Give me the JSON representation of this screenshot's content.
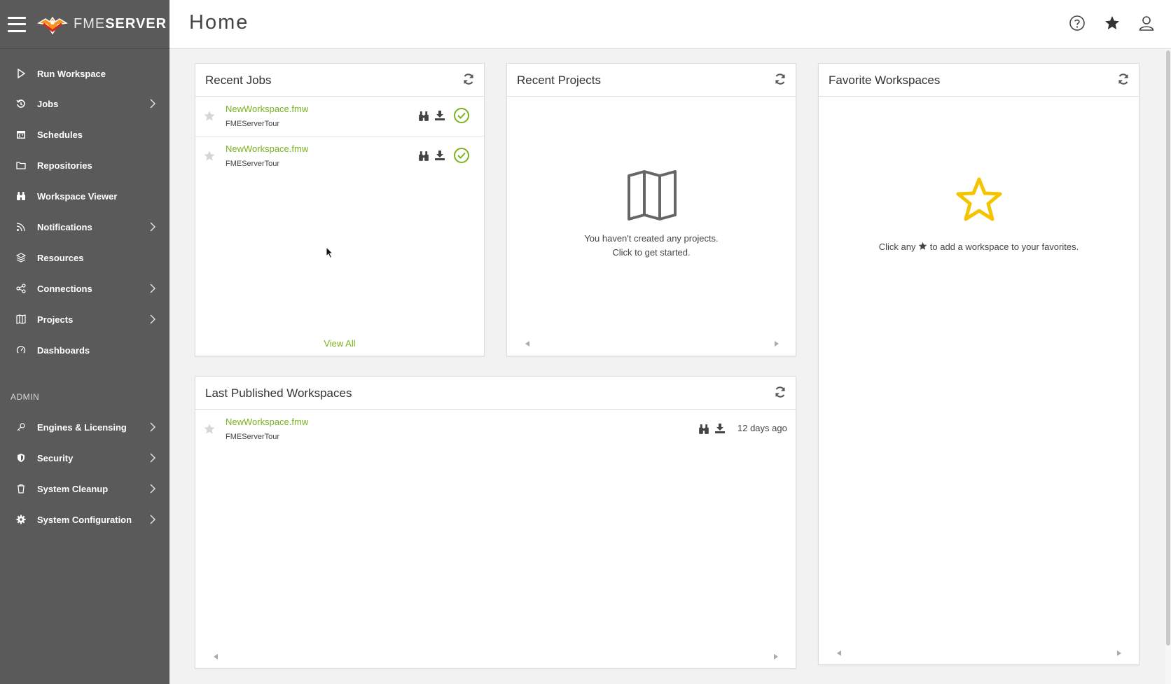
{
  "brand": {
    "name_thin": "FME",
    "name_bold": "SERVER"
  },
  "header": {
    "title": "Home"
  },
  "sidebar": {
    "items": [
      {
        "label": "Run Workspace",
        "icon": "play-outline-icon",
        "has_submenu": false
      },
      {
        "label": "Jobs",
        "icon": "history-icon",
        "has_submenu": true
      },
      {
        "label": "Schedules",
        "icon": "calendar-icon",
        "has_submenu": false
      },
      {
        "label": "Repositories",
        "icon": "folder-icon",
        "has_submenu": false
      },
      {
        "label": "Workspace Viewer",
        "icon": "binoculars-icon",
        "has_submenu": false
      },
      {
        "label": "Notifications",
        "icon": "rss-icon",
        "has_submenu": true
      },
      {
        "label": "Resources",
        "icon": "layers-icon",
        "has_submenu": false
      },
      {
        "label": "Connections",
        "icon": "share-icon",
        "has_submenu": true
      },
      {
        "label": "Projects",
        "icon": "map-icon",
        "has_submenu": true
      },
      {
        "label": "Dashboards",
        "icon": "gauge-icon",
        "has_submenu": false
      }
    ],
    "admin_label": "ADMIN",
    "admin_items": [
      {
        "label": "Engines & Licensing",
        "icon": "key-icon",
        "has_submenu": true
      },
      {
        "label": "Security",
        "icon": "shield-icon",
        "has_submenu": true
      },
      {
        "label": "System Cleanup",
        "icon": "trash-icon",
        "has_submenu": true
      },
      {
        "label": "System Configuration",
        "icon": "gear-icon",
        "has_submenu": true
      }
    ]
  },
  "recent_jobs": {
    "title": "Recent Jobs",
    "rows": [
      {
        "name": "NewWorkspace.fmw",
        "repository": "FMEServerTour",
        "status": "success"
      },
      {
        "name": "NewWorkspace.fmw",
        "repository": "FMEServerTour",
        "status": "success"
      }
    ],
    "view_all": "View All"
  },
  "recent_projects": {
    "title": "Recent Projects",
    "empty_line1": "You haven't created any projects.",
    "empty_line2": "Click to get started."
  },
  "favorite_workspaces": {
    "title": "Favorite Workspaces",
    "empty_before": "Click any",
    "empty_after": "to add a workspace to your favorites."
  },
  "last_published": {
    "title": "Last Published Workspaces",
    "rows": [
      {
        "name": "NewWorkspace.fmw",
        "repository": "FMEServerTour",
        "ago": "12 days ago"
      }
    ]
  },
  "colors": {
    "sidebar_bg": "#5a5a5a",
    "accent_green": "#7ab31f",
    "star_yellow": "#f5c400"
  }
}
